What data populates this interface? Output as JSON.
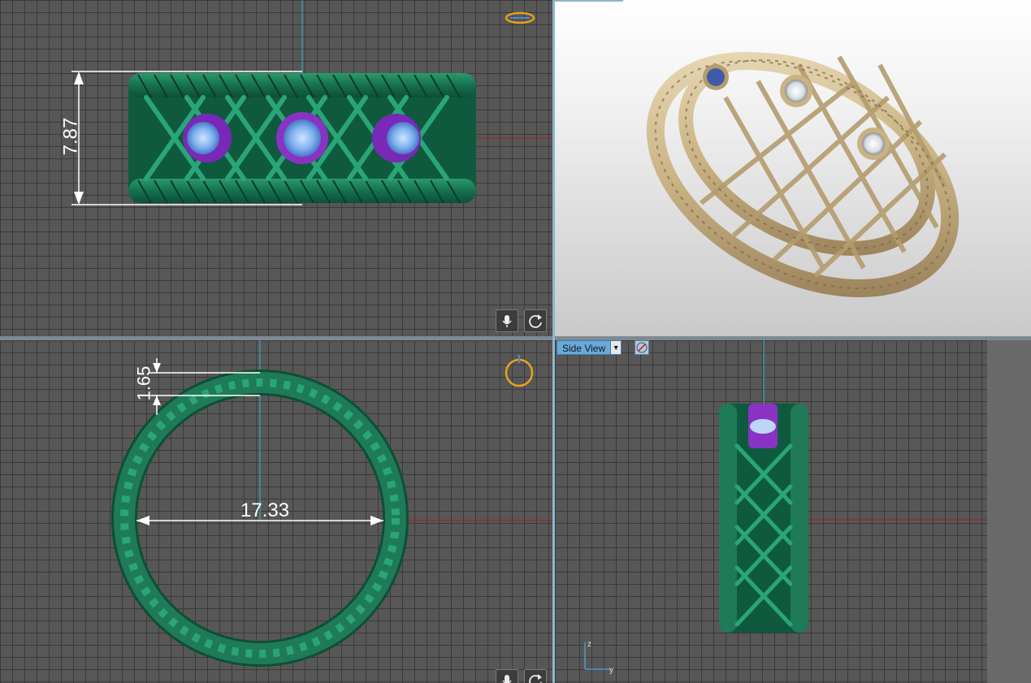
{
  "viewports": {
    "front": {
      "dimension_height": "7.87"
    },
    "top": {
      "dimension_wall": "1.65",
      "dimension_diameter": "17.33"
    },
    "side": {
      "view_selector_label": "Side View",
      "axis_z": "z",
      "axis_y": "y"
    }
  },
  "controls": {
    "microphone_icon": "mic",
    "rotate_icon": "rotate",
    "dropdown_arrow": "▼"
  },
  "colors": {
    "grid_bg": "#575757",
    "ring_green": "#1f7a58",
    "gem_purple": "#8a32c4",
    "gold": "#cdb88c",
    "axis_red": "#b11a1a",
    "axis_cyan": "#2fb9c9",
    "gizmo_orange": "#e8a020"
  }
}
